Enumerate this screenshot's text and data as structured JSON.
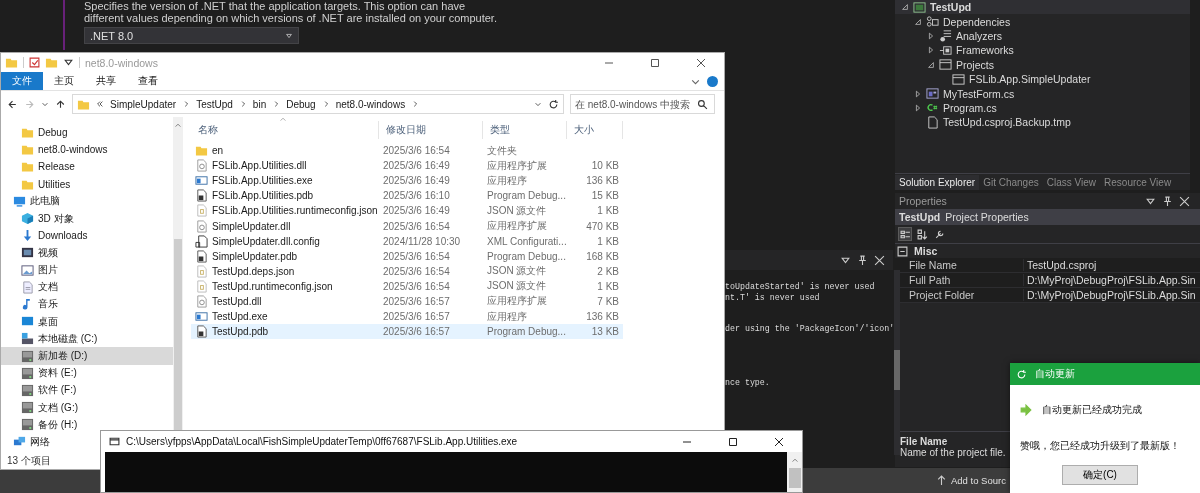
{
  "project_settings": {
    "description": [
      "Specifies the version of .NET that the application targets. This option can have",
      "different values depending on which versions of .NET are installed on your computer."
    ],
    "target_framework": ".NET 8.0"
  },
  "solution_explorer": {
    "tree": [
      {
        "label": "TestUpd",
        "kind": "csproj",
        "expanded": true,
        "selected": true,
        "children": [
          {
            "label": "Dependencies",
            "kind": "deps",
            "expanded": true,
            "selected": false,
            "children": [
              {
                "label": "Analyzers",
                "kind": "analyzer",
                "expanded": false,
                "selected": false
              },
              {
                "label": "Frameworks",
                "kind": "framework",
                "expanded": false,
                "selected": false
              },
              {
                "label": "Projects",
                "kind": "window",
                "expanded": true,
                "selected": false,
                "children": [
                  {
                    "label": "FSLib.App.SimpleUpdater",
                    "kind": "window",
                    "selected": false
                  }
                ]
              }
            ]
          },
          {
            "label": "MyTestForm.cs",
            "kind": "form",
            "expanded": false,
            "selected": false
          },
          {
            "label": "Program.cs",
            "kind": "cs",
            "expanded": false,
            "selected": false
          },
          {
            "label": "TestUpd.csproj.Backup.tmp",
            "kind": "file",
            "selected": false
          }
        ]
      }
    ],
    "tabs": [
      {
        "label": "Solution Explorer",
        "selected": true
      },
      {
        "label": "Git Changes",
        "selected": false
      },
      {
        "label": "Class View",
        "selected": false
      },
      {
        "label": "Resource View",
        "selected": false
      }
    ]
  },
  "properties": {
    "title": "Properties",
    "object": "TestUpd",
    "object_type": "Project Properties",
    "category": {
      "label": "Misc",
      "expanded": true
    },
    "rows": [
      {
        "name": "File Name",
        "value": "TestUpd.csproj"
      },
      {
        "name": "Full Path",
        "value": "D:\\MyProj\\DebugProj\\FSLib.App.Sin"
      },
      {
        "name": "Project Folder",
        "value": "D:\\MyProj\\DebugProj\\FSLib.App.Sin"
      }
    ],
    "description": {
      "title": "File Name",
      "text": "Name of the project file."
    }
  },
  "output": {
    "lines": [
      "toUpdateStarted' is never used",
      "nt.T' is never used",
      "der using the 'PackageIcon'/'icon'",
      "nce type."
    ]
  },
  "status_bar": {
    "text": "Add to Sourc"
  },
  "explorer": {
    "title": "net8.0-windows",
    "ribbon_tabs": [
      {
        "label": "文件",
        "kind": "file"
      },
      {
        "label": "主页",
        "kind": "tab"
      },
      {
        "label": "共享",
        "kind": "tab"
      },
      {
        "label": "查看",
        "kind": "tab"
      }
    ],
    "breadcrumb": [
      "SimpleUpdater",
      "TestUpd",
      "bin",
      "Debug",
      "net8.0-windows"
    ],
    "search": {
      "placeholder": "在 net8.0-windows 中搜索"
    },
    "nav": [
      {
        "label": "Debug",
        "kind": "folder",
        "selected": false
      },
      {
        "label": "net8.0-windows",
        "kind": "folder",
        "selected": false
      },
      {
        "label": "Release",
        "kind": "folder",
        "selected": false
      },
      {
        "label": "Utilities",
        "kind": "folder",
        "selected": false
      },
      {
        "label": "此电脑",
        "kind": "pc",
        "selected": false,
        "children": [
          {
            "label": "3D 对象",
            "kind": "cube",
            "selected": false
          },
          {
            "label": "Downloads",
            "kind": "download",
            "selected": false
          },
          {
            "label": "视频",
            "kind": "video",
            "selected": false
          },
          {
            "label": "图片",
            "kind": "picture",
            "selected": false
          },
          {
            "label": "文档",
            "kind": "document",
            "selected": false
          },
          {
            "label": "音乐",
            "kind": "music",
            "selected": false
          },
          {
            "label": "桌面",
            "kind": "desktop",
            "selected": false
          },
          {
            "label": "本地磁盘 (C:)",
            "kind": "osdrive",
            "selected": false
          },
          {
            "label": "新加卷 (D:)",
            "kind": "drive",
            "selected": true
          },
          {
            "label": "资料 (E:)",
            "kind": "drive",
            "selected": false
          },
          {
            "label": "软件 (F:)",
            "kind": "drive",
            "selected": false
          },
          {
            "label": "文档 (G:)",
            "kind": "drive",
            "selected": false
          },
          {
            "label": "备份 (H:)",
            "kind": "drive",
            "selected": false
          }
        ]
      },
      {
        "label": "网络",
        "kind": "network",
        "selected": false
      }
    ],
    "columns": [
      "名称",
      "修改日期",
      "类型",
      "大小"
    ],
    "rows": [
      {
        "name": "en",
        "date": "2025/3/6 16:54",
        "type": "文件夹",
        "kind": "folder",
        "selected": false
      },
      {
        "name": "FSLib.App.Utilities.dll",
        "date": "2025/3/6 16:49",
        "type": "应用程序扩展",
        "size": "10 KB",
        "kind": "dll",
        "selected": false
      },
      {
        "name": "FSLib.App.Utilities.exe",
        "date": "2025/3/6 16:49",
        "type": "应用程序",
        "size": "136 KB",
        "kind": "exe",
        "selected": false
      },
      {
        "name": "FSLib.App.Utilities.pdb",
        "date": "2025/3/6 16:10",
        "type": "Program Debug...",
        "size": "15 KB",
        "kind": "pdb",
        "selected": false
      },
      {
        "name": "FSLib.App.Utilities.runtimeconfig.json",
        "date": "2025/3/6 16:49",
        "type": "JSON 源文件",
        "size": "1 KB",
        "kind": "json",
        "selected": false
      },
      {
        "name": "SimpleUpdater.dll",
        "date": "2025/3/6 16:54",
        "type": "应用程序扩展",
        "size": "470 KB",
        "kind": "dll",
        "selected": false
      },
      {
        "name": "SimpleUpdater.dll.config",
        "date": "2024/11/28 10:30",
        "type": "XML Configurati...",
        "size": "1 KB",
        "kind": "config",
        "selected": false
      },
      {
        "name": "SimpleUpdater.pdb",
        "date": "2025/3/6 16:54",
        "type": "Program Debug...",
        "size": "168 KB",
        "kind": "pdb",
        "selected": false
      },
      {
        "name": "TestUpd.deps.json",
        "date": "2025/3/6 16:54",
        "type": "JSON 源文件",
        "size": "2 KB",
        "kind": "json",
        "selected": false
      },
      {
        "name": "TestUpd.runtimeconfig.json",
        "date": "2025/3/6 16:54",
        "type": "JSON 源文件",
        "size": "1 KB",
        "kind": "json",
        "selected": false
      },
      {
        "name": "TestUpd.dll",
        "date": "2025/3/6 16:57",
        "type": "应用程序扩展",
        "size": "7 KB",
        "kind": "dll",
        "selected": false
      },
      {
        "name": "TestUpd.exe",
        "date": "2025/3/6 16:57",
        "type": "应用程序",
        "size": "136 KB",
        "kind": "exe",
        "selected": false
      },
      {
        "name": "TestUpd.pdb",
        "date": "2025/3/6 16:57",
        "type": "Program Debug...",
        "size": "13 KB",
        "kind": "pdb",
        "selected": true
      }
    ],
    "status": "13 个项目"
  },
  "console": {
    "title": "C:\\Users\\yfpps\\AppData\\Local\\FishSimpleUpdaterTemp\\0ff67687\\FSLib.App.Utilities.exe"
  },
  "dialog": {
    "title": "自动更新",
    "heading": "自动更新已经成功完成",
    "message": "赞哦，您已经成功升级到了最新版！",
    "button": "确定(C)"
  }
}
